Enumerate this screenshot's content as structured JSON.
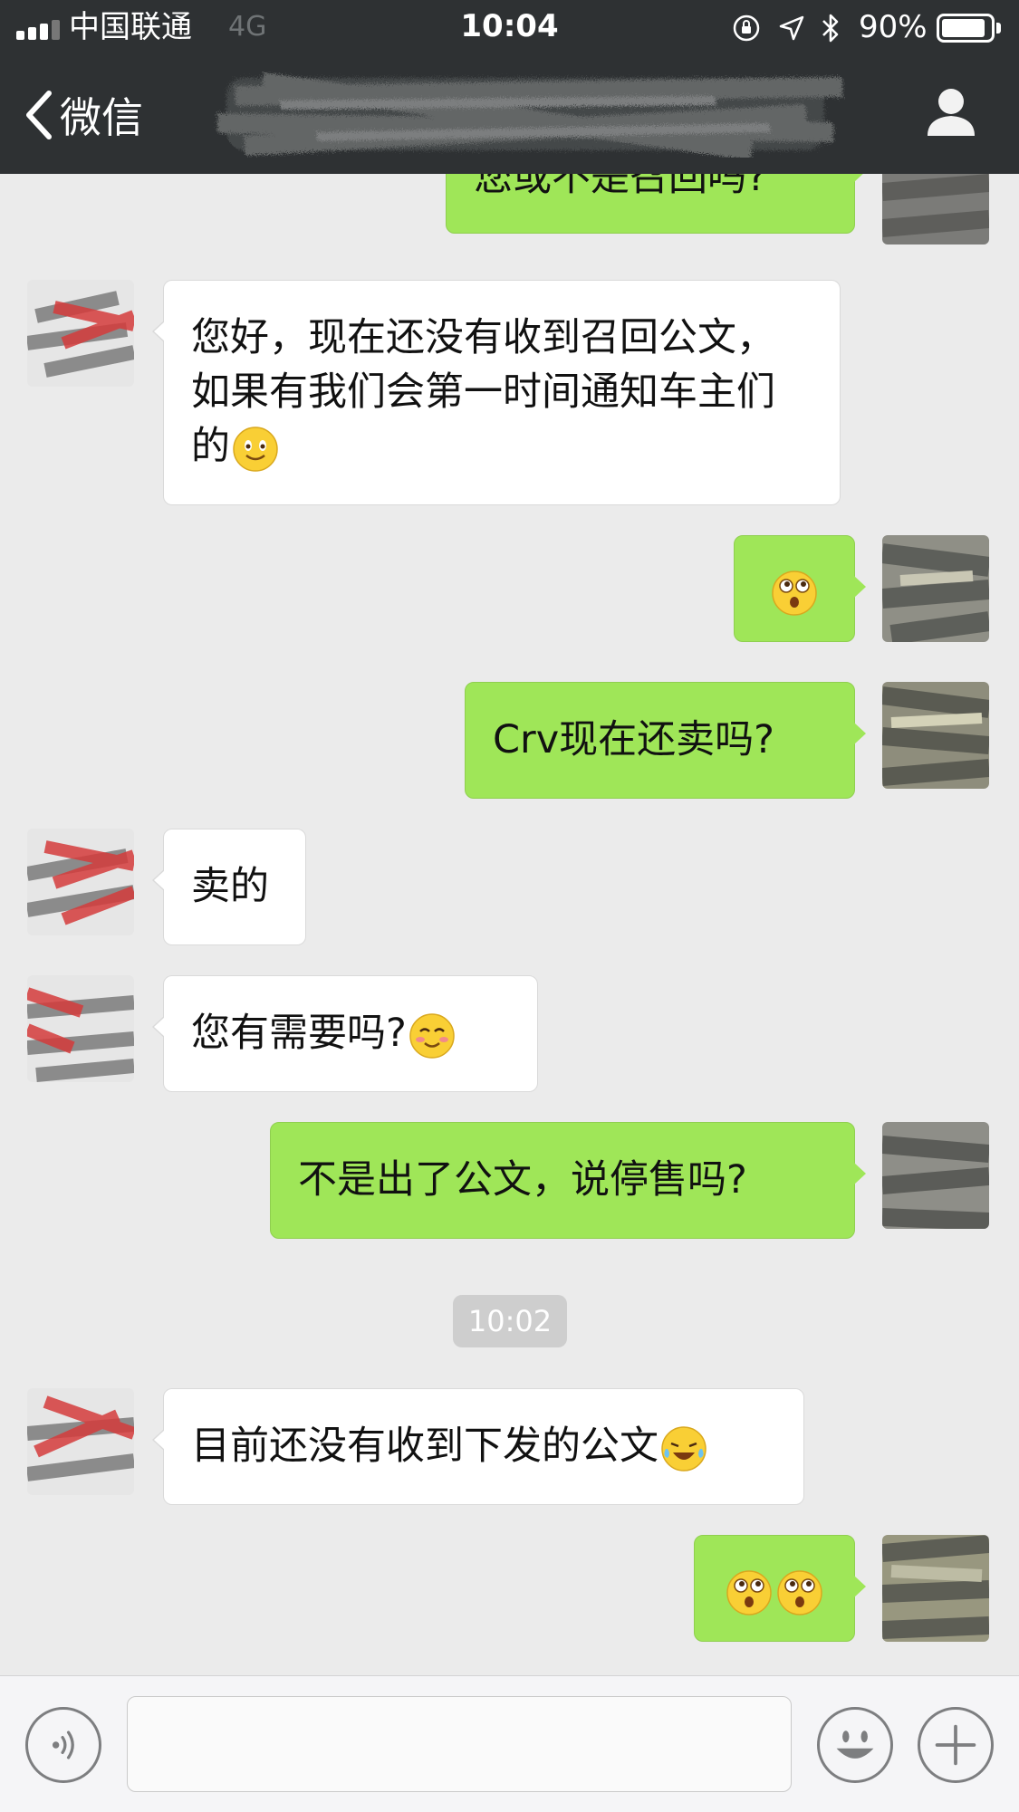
{
  "status_bar": {
    "carrier": "中国联通",
    "network": "4G",
    "time": "10:04",
    "battery_percent": "90%",
    "battery_level": 0.9,
    "icons": [
      "orientation-lock-icon",
      "location-arrow-icon",
      "bluetooth-icon"
    ]
  },
  "nav": {
    "back_label": "微信",
    "title_redacted": true,
    "right_icon": "profile-icon"
  },
  "messages": [
    {
      "side": "out",
      "text": "您或不是召回吗?",
      "partially_hidden": true
    },
    {
      "side": "in",
      "text": "您好，现在还没有收到召回公文，如果有我们会第一时间通知车主们的",
      "emoji": [
        "smile-emoji"
      ]
    },
    {
      "side": "out",
      "text": "",
      "emoji": [
        "dizzy-eyes-emoji"
      ]
    },
    {
      "side": "out",
      "text": "Crv现在还卖吗?"
    },
    {
      "side": "in",
      "text": "卖的"
    },
    {
      "side": "in",
      "text": "您有需要吗?",
      "emoji": [
        "blush-emoji"
      ]
    },
    {
      "side": "out",
      "text": "不是出了公文，说停售吗?"
    },
    {
      "side": "in",
      "text": "目前还没有收到下发的公文",
      "emoji": [
        "laugh-cry-emoji"
      ]
    },
    {
      "side": "out",
      "text": "",
      "emoji": [
        "dizzy-eyes-emoji",
        "dizzy-eyes-emoji"
      ]
    }
  ],
  "timestamp": "10:02",
  "input_bar": {
    "voice_icon": "voice-icon",
    "emoji_icon": "emoji-icon",
    "plus_icon": "plus-icon",
    "input_value": ""
  },
  "colors": {
    "nav_bg": "#2e3133",
    "chat_bg": "#ebebeb",
    "bubble_out": "#9fe658",
    "bubble_in": "#ffffff",
    "timestamp_bg": "#cecece"
  }
}
